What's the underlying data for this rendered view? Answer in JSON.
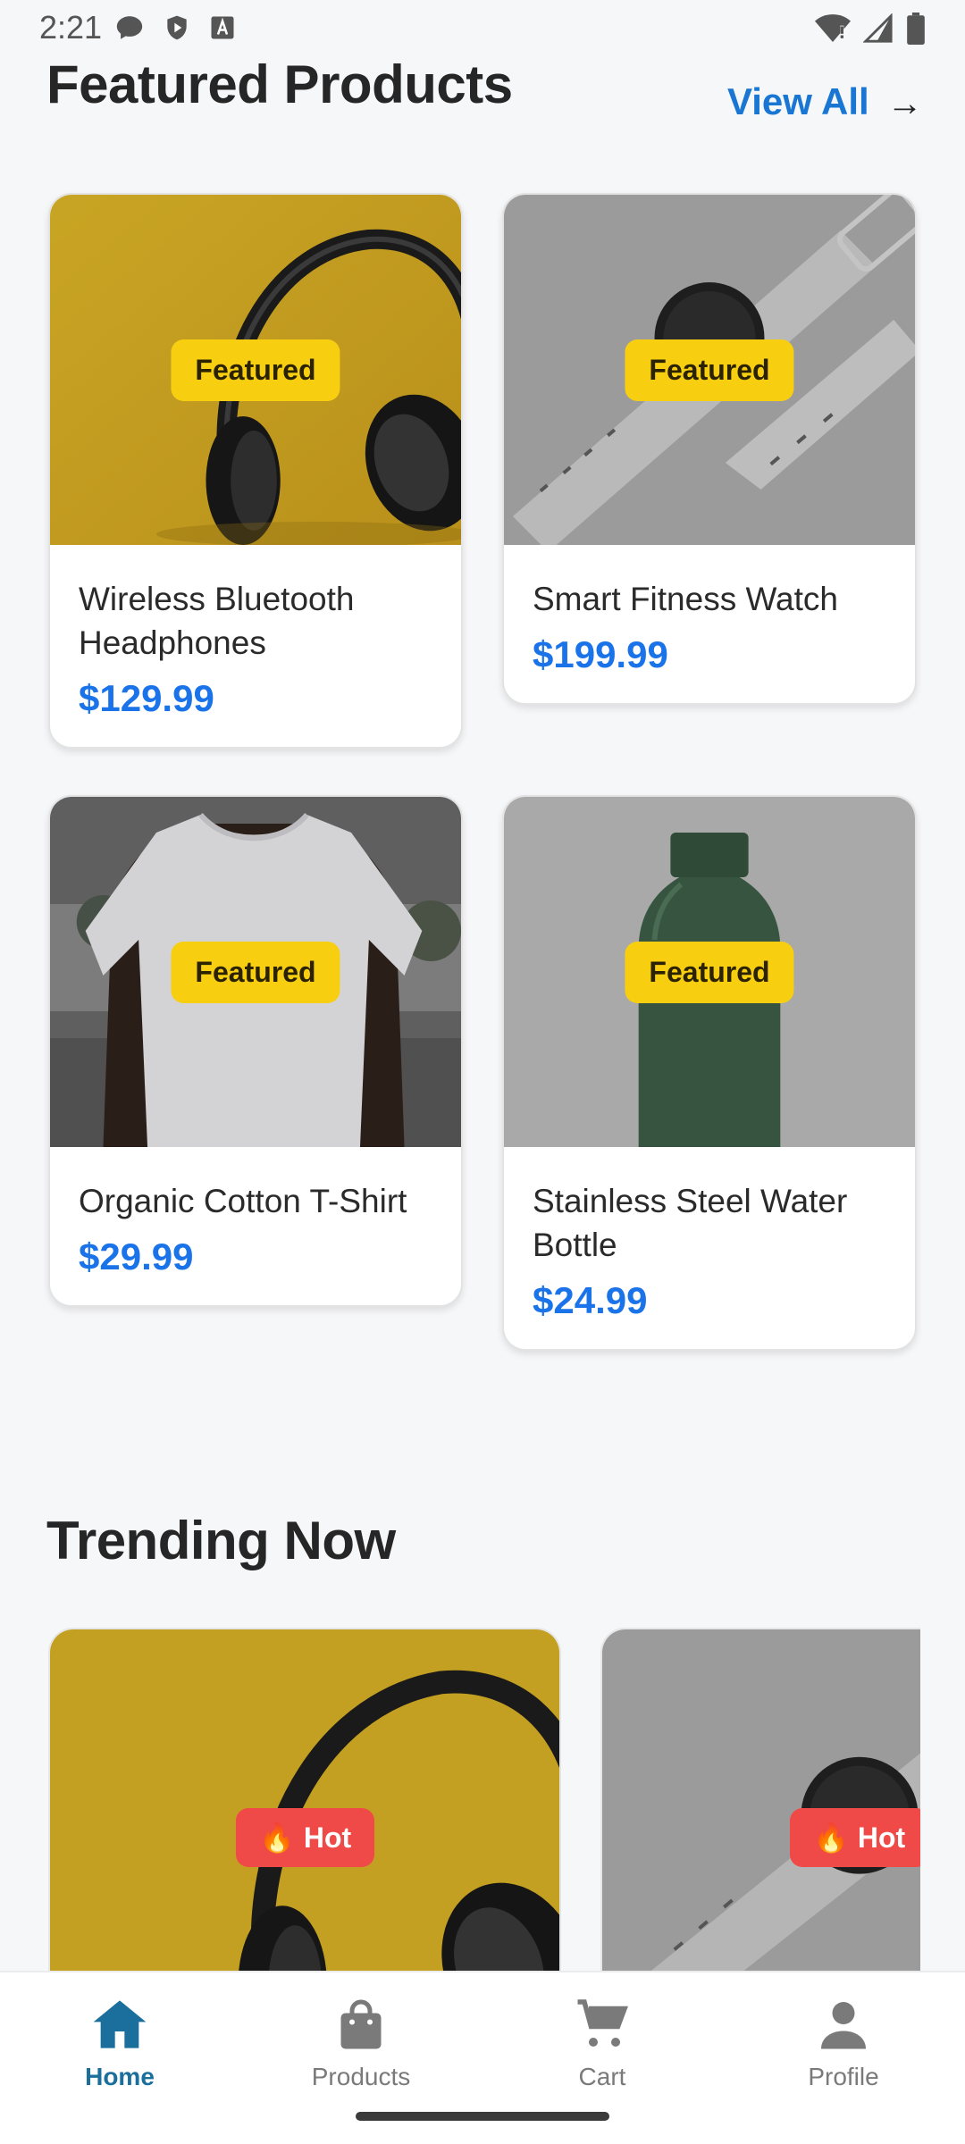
{
  "status_bar": {
    "time": "2:21",
    "left_icons": [
      "chat-bubble-icon",
      "shield-icon",
      "a-box-icon"
    ],
    "right_icons": [
      "wifi-icon",
      "signal-icon",
      "battery-icon"
    ]
  },
  "featured": {
    "title": "Featured Products",
    "view_all": "View All",
    "arrow": "→",
    "products": [
      {
        "name": "Wireless Bluetooth Headphones",
        "price": "$129.99",
        "badge": "Featured"
      },
      {
        "name": "Smart Fitness Watch",
        "price": "$199.99",
        "badge": "Featured"
      },
      {
        "name": "Organic Cotton T-Shirt",
        "price": "$29.99",
        "badge": "Featured"
      },
      {
        "name": "Stainless Steel Water Bottle",
        "price": "$24.99",
        "badge": "Featured"
      }
    ]
  },
  "trending": {
    "title": "Trending Now",
    "items": [
      {
        "badge": "Hot",
        "badge_icon": "🔥"
      },
      {
        "badge": "Hot",
        "badge_icon": "🔥"
      }
    ]
  },
  "bottom_nav": {
    "items": [
      {
        "label": "Home",
        "active": true
      },
      {
        "label": "Products",
        "active": false
      },
      {
        "label": "Cart",
        "active": false
      },
      {
        "label": "Profile",
        "active": false
      }
    ]
  },
  "colors": {
    "accent": "#1a73e8",
    "nav_active": "#1a6f9d",
    "featured_badge": "#f8cf10",
    "hot_badge": "#f04a48",
    "background": "#f6f7f9"
  }
}
